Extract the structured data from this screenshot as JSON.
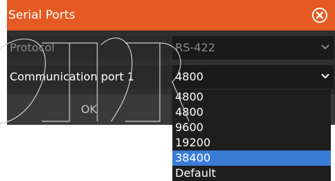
{
  "dialog": {
    "title": "Serial Ports",
    "close_icon": "close-icon",
    "rows": {
      "protocol": {
        "label": "Protocol",
        "value": "RS-422"
      },
      "communication_port": {
        "label": "Communication port 1",
        "value": "4800"
      }
    },
    "ok_label": "OK",
    "dropdown": {
      "options": [
        "4800",
        "4800",
        "9600",
        "19200",
        "38400",
        "Default"
      ],
      "selected_index": 4
    }
  },
  "colors": {
    "titlebar": "#e55a22",
    "panel": "#2f2f2f",
    "selected": "#3a7bd5"
  }
}
